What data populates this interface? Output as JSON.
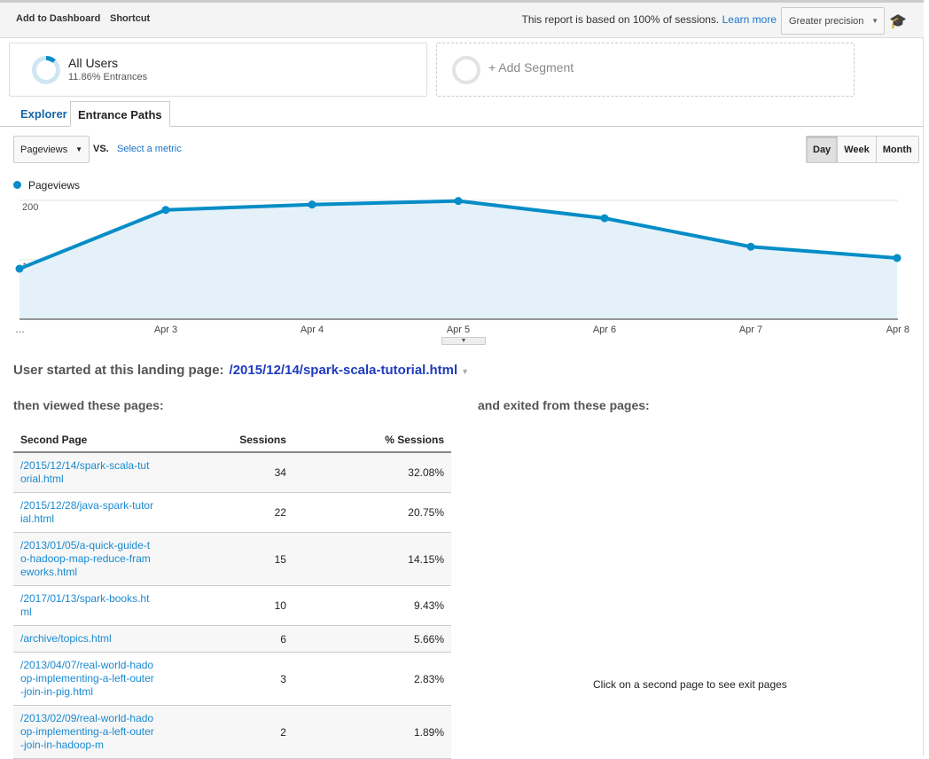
{
  "toolbar": {
    "add_to_dashboard": "Add to Dashboard",
    "shortcut": "Shortcut",
    "sampling_note": "This report is based on 100% of sessions.",
    "learn_more": "Learn more",
    "precision": "Greater precision"
  },
  "segments": {
    "all_users": {
      "title": "All Users",
      "subtitle": "11.86% Entrances",
      "percent": 11.86
    },
    "add_segment": "+ Add Segment"
  },
  "tabs": [
    {
      "label": "Explorer"
    },
    {
      "label": "Entrance Paths",
      "active": true
    }
  ],
  "controls": {
    "metric": "Pageviews",
    "vs": "VS.",
    "select_metric": "Select a metric",
    "periods": [
      "Day",
      "Week",
      "Month"
    ],
    "active_period": "Day"
  },
  "chart_data": {
    "type": "area",
    "title": "",
    "legend": [
      "Pageviews"
    ],
    "x": [
      "…",
      "Apr 3",
      "Apr 4",
      "Apr 5",
      "Apr 6",
      "Apr 7",
      "Apr 8"
    ],
    "series": [
      {
        "name": "Pageviews",
        "values": [
          85,
          184,
          193,
          199,
          170,
          122,
          103
        ]
      }
    ],
    "yticks": [
      100,
      200
    ],
    "ylim": [
      0,
      200
    ],
    "color": "#058dc7",
    "fill": "#e5f1f8"
  },
  "landing": {
    "label": "User started at this landing page:",
    "page": "/2015/12/14/spark-scala-tutorial.html"
  },
  "left_heading": "then viewed these pages:",
  "right_heading": "and exited from these pages:",
  "table": {
    "headers": [
      "Second Page",
      "Sessions",
      "% Sessions"
    ],
    "rows": [
      {
        "page": "/2015/12/14/spark-scala-tutorial.html",
        "sessions": "34",
        "pct": "32.08%"
      },
      {
        "page": "/2015/12/28/java-spark-tutorial.html",
        "sessions": "22",
        "pct": "20.75%"
      },
      {
        "page": "/2013/01/05/a-quick-guide-to-hadoop-map-reduce-frameworks.html",
        "sessions": "15",
        "pct": "14.15%"
      },
      {
        "page": "/2017/01/13/spark-books.html",
        "sessions": "10",
        "pct": "9.43%"
      },
      {
        "page": "/archive/topics.html",
        "sessions": "6",
        "pct": "5.66%"
      },
      {
        "page": "/2013/04/07/real-world-hadoop-implementing-a-left-outer-join-in-pig.html",
        "sessions": "3",
        "pct": "2.83%"
      },
      {
        "page": "/2013/02/09/real-world-hadoop-implementing-a-left-outer-join-in-hadoop-m",
        "sessions": "2",
        "pct": "1.89%"
      }
    ]
  },
  "exit_message": "Click on a second page to see exit pages"
}
